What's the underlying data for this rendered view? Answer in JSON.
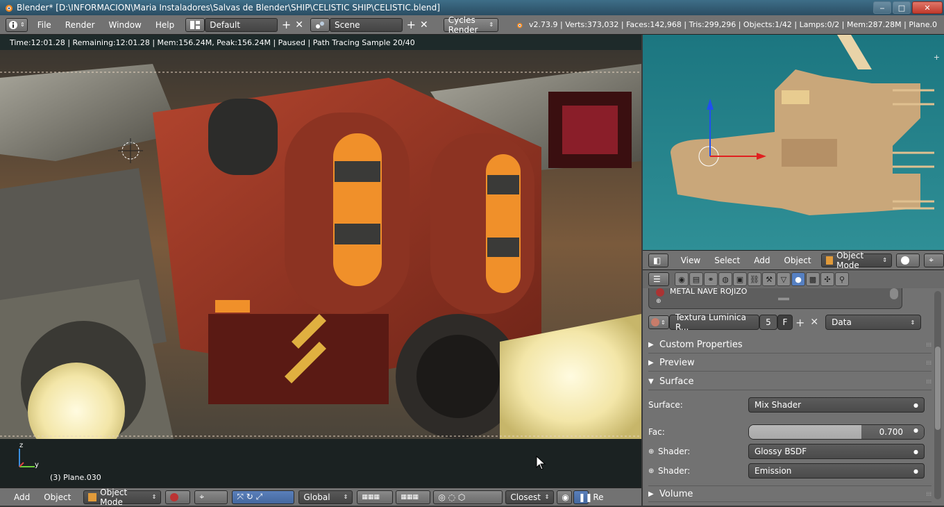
{
  "window": {
    "title": "Blender* [D:\\INFORMACION\\Maria Instaladores\\Salvas de Blender\\SHIP\\CELISTIC SHIP\\CELISTIC.blend]",
    "min": "‒",
    "max": "□",
    "close": "✕"
  },
  "info_header": {
    "menus": [
      "File",
      "Render",
      "Window",
      "Help"
    ],
    "layout": "Default",
    "scene": "Scene",
    "engine": "Cycles Render",
    "stats": "v2.73.9 | Verts:373,032 | Faces:142,968 | Tris:299,296 | Objects:1/42 | Lamps:0/2 | Mem:287.28M | Plane.0"
  },
  "render_view": {
    "status": "Time:12:01.28 | Remaining:12:01.28 | Mem:156.24M, Peak:156.24M | Paused | Path Tracing Sample 20/40",
    "object_label": "(3) Plane.030",
    "axis_z": "z",
    "axis_y": "y"
  },
  "bottom_header": {
    "menus": [
      "Add",
      "Object"
    ],
    "mode": "Object Mode",
    "orientation": "Global",
    "snap": "Closest",
    "trailing": "Re"
  },
  "view3d_header": {
    "menus": [
      "View",
      "Select",
      "Add",
      "Object"
    ],
    "mode": "Object Mode"
  },
  "properties": {
    "material_name": "METAL NAVE  ROJIZO",
    "texture_name": "Textura Luminica R...",
    "users": "5",
    "fake_user": "F",
    "data_link": "Data",
    "panels": {
      "custom_properties": "Custom Properties",
      "preview": "Preview",
      "surface": "Surface",
      "volume": "Volume"
    },
    "surface_label": "Surface:",
    "surface_value": "Mix Shader",
    "fac_label": "Fac:",
    "fac_value": "0.700",
    "fac": 0.7,
    "shader1_label": "Shader:",
    "shader1_value": "Glossy BSDF",
    "shader2_label": "Shader:",
    "shader2_value": "Emission"
  },
  "colors": {
    "ui_grey": "#727272",
    "active_tab": "#5680c2",
    "viewport_teal": "#2f8f96"
  }
}
